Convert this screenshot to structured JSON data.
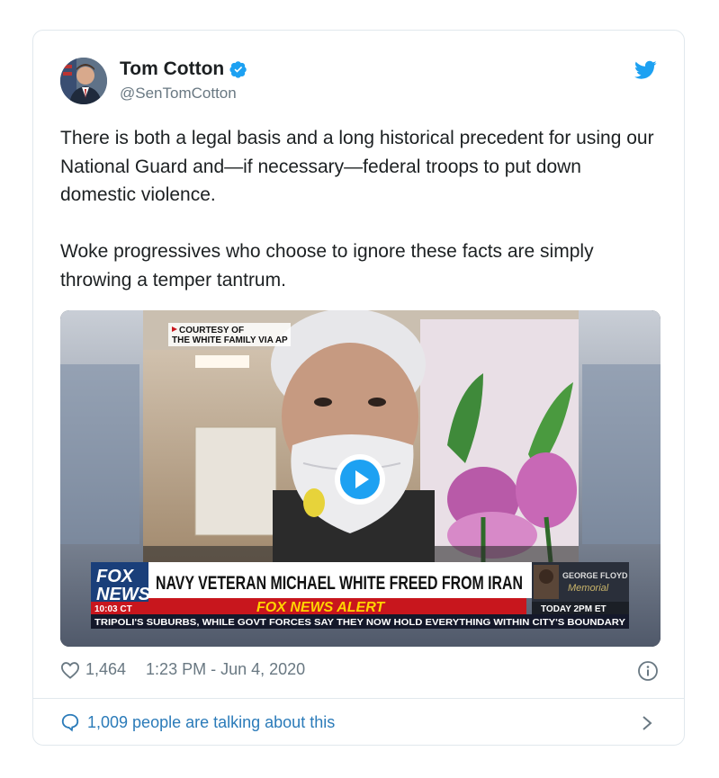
{
  "tweet": {
    "author_name": "Tom Cotton",
    "author_handle": "@SenTomCotton",
    "text": "There is both a legal basis and a long historical precedent for using our National Guard and—if necessary—federal troops to put down domestic violence.\n\nWoke progressives who choose to ignore these facts are simply throwing a temper tantrum.",
    "likes": "1,464",
    "timestamp": "1:23 PM - Jun 4, 2020",
    "talking": "1,009 people are talking about this"
  },
  "video": {
    "courtesy": "COURTESY OF",
    "courtesy2": "THE WHITE FAMILY VIA AP",
    "logo_top": "FOX",
    "logo_bottom": "NEWS",
    "clock": "10:03 CT",
    "headline": "NAVY VETERAN MICHAEL WHITE FREED FROM IRAN",
    "alert": "FOX NEWS ALERT",
    "promo_title": "GEORGE FLOYD",
    "promo_sub": "Memorial",
    "promo_time": "TODAY 2PM ET",
    "ticker": "TRIPOLI'S SUBURBS, WHILE GOVT FORCES SAY THEY NOW HOLD EVERYTHING WITHIN CITY'S BOUNDARY"
  },
  "colors": {
    "accent": "#1da1f2",
    "link": "#2b7bb9",
    "fox_blue": "#1a3f7a",
    "alert_red": "#c8161d",
    "alert_yellow": "#ffd400"
  }
}
